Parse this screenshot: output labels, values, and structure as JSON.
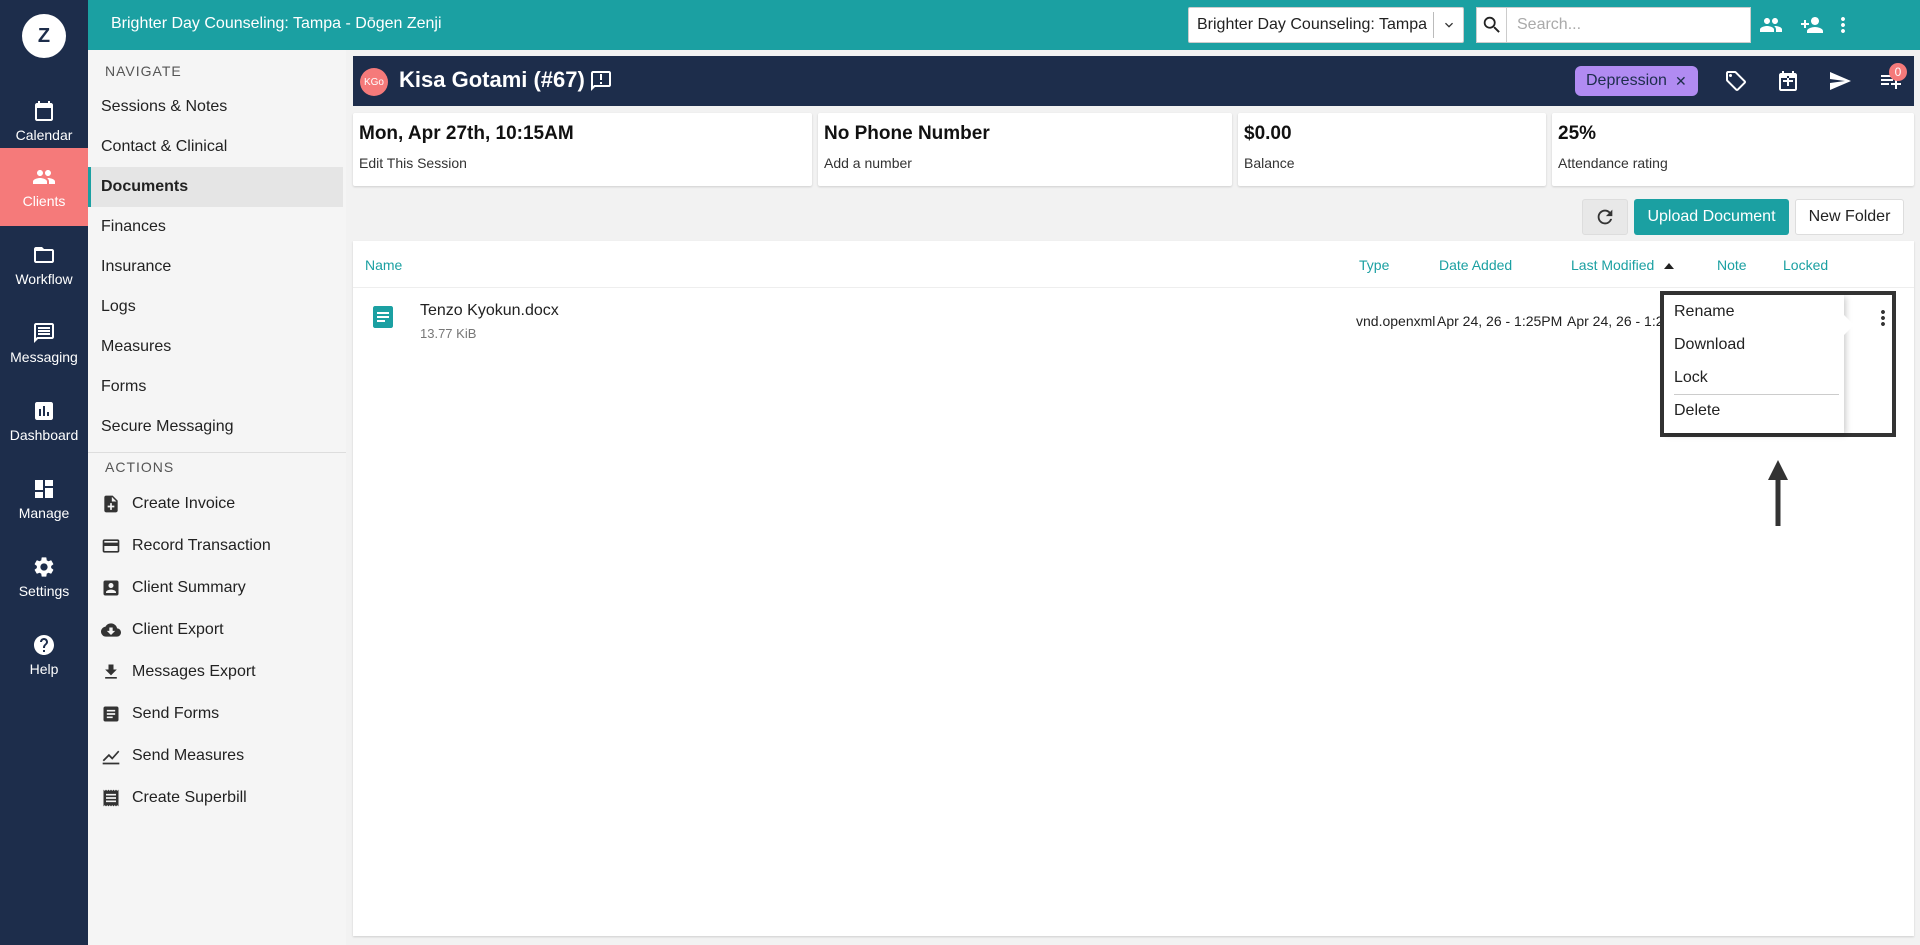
{
  "app": {
    "logo_letter": "Z",
    "header_title": "Brighter Day Counseling: Tampa - Dōgen Zenji"
  },
  "rail": [
    {
      "label": "Calendar",
      "icon": "calendar-icon"
    },
    {
      "label": "Clients",
      "icon": "clients-icon",
      "active": true
    },
    {
      "label": "Workflow",
      "icon": "folder-icon"
    },
    {
      "label": "Messaging",
      "icon": "message-icon"
    },
    {
      "label": "Dashboard",
      "icon": "chart-icon"
    },
    {
      "label": "Manage",
      "icon": "dashboard-icon"
    },
    {
      "label": "Settings",
      "icon": "gear-icon"
    },
    {
      "label": "Help",
      "icon": "help-icon"
    }
  ],
  "topbar": {
    "practice_select": "Brighter Day Counseling: Tampa",
    "search_placeholder": "Search...",
    "icons": [
      "bell-icon",
      "eye-icon",
      "group-icon",
      "add-person-icon",
      "more-vert-icon"
    ]
  },
  "subnav": {
    "navigate_heading": "NAVIGATE",
    "items": [
      "Sessions & Notes",
      "Contact & Clinical",
      "Documents",
      "Finances",
      "Insurance",
      "Logs",
      "Measures",
      "Forms",
      "Secure Messaging"
    ],
    "active_item": "Documents",
    "actions_heading": "ACTIONS",
    "actions": [
      {
        "label": "Create Invoice",
        "icon": "invoice-icon"
      },
      {
        "label": "Record Transaction",
        "icon": "credit-card-icon"
      },
      {
        "label": "Client Summary",
        "icon": "contact-card-icon"
      },
      {
        "label": "Client Export",
        "icon": "cloud-download-icon"
      },
      {
        "label": "Messages Export",
        "icon": "download-icon"
      },
      {
        "label": "Send Forms",
        "icon": "form-icon"
      },
      {
        "label": "Send Measures",
        "icon": "line-chart-icon"
      },
      {
        "label": "Create Superbill",
        "icon": "receipt-icon"
      }
    ]
  },
  "client": {
    "initials": "KGo",
    "name": "Kisa Gotami (#67)",
    "tag": "Depression",
    "tag_color": "#b18bf2",
    "queue_count": "0"
  },
  "cards": [
    {
      "big": "Mon, Apr 27th, 10:15AM",
      "small": "Edit This Session"
    },
    {
      "big": "No Phone Number",
      "small": "Add a number"
    },
    {
      "big": "$0.00",
      "small": "Balance"
    },
    {
      "big": "25%",
      "small": "Attendance rating"
    }
  ],
  "toolbar": {
    "upload_label": "Upload Document",
    "new_folder_label": "New Folder"
  },
  "table": {
    "columns": [
      "Name",
      "Type",
      "Date Added",
      "Last Modified",
      "Note",
      "Locked"
    ],
    "sort_column": "Last Modified",
    "rows": [
      {
        "name": "Tenzo Kyokun.docx",
        "size": "13.77 KiB",
        "type": "vnd.openxml",
        "date_added": "Apr 24, 26 - 1:25PM",
        "last_modified": "Apr 24, 26 - 1:2"
      }
    ]
  },
  "context_menu": {
    "items": [
      "Rename",
      "Download",
      "Lock",
      "Delete"
    ]
  },
  "colors": {
    "teal": "#1ba0a2",
    "navy": "#1d2d4b",
    "coral": "#f57a7a"
  }
}
